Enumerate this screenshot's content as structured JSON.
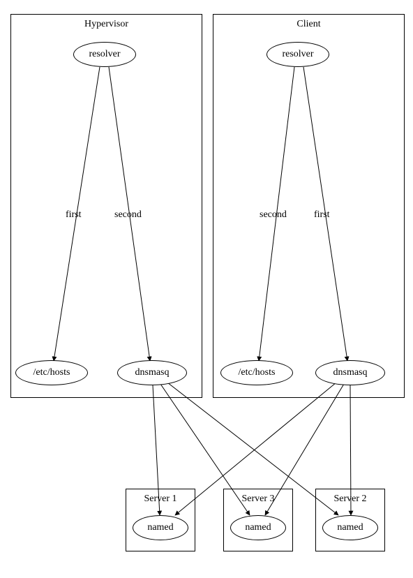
{
  "chart_data": {
    "type": "graph",
    "clusters": [
      {
        "id": "hypervisor",
        "label": "Hypervisor",
        "nodes": [
          "h_resolver",
          "h_etchosts",
          "h_dnsmasq"
        ]
      },
      {
        "id": "client",
        "label": "Client",
        "nodes": [
          "c_resolver",
          "c_etchosts",
          "c_dnsmasq"
        ]
      },
      {
        "id": "server1",
        "label": "Server 1",
        "nodes": [
          "s1_named"
        ]
      },
      {
        "id": "server3",
        "label": "Server 3",
        "nodes": [
          "s3_named"
        ]
      },
      {
        "id": "server2",
        "label": "Server 2",
        "nodes": [
          "s2_named"
        ]
      }
    ],
    "nodes": {
      "h_resolver": "resolver",
      "h_etchosts": "/etc/hosts",
      "h_dnsmasq": "dnsmasq",
      "c_resolver": "resolver",
      "c_etchosts": "/etc/hosts",
      "c_dnsmasq": "dnsmasq",
      "s1_named": "named",
      "s3_named": "named",
      "s2_named": "named"
    },
    "edges": [
      {
        "from": "h_resolver",
        "to": "h_etchosts",
        "label": "first"
      },
      {
        "from": "h_resolver",
        "to": "h_dnsmasq",
        "label": "second"
      },
      {
        "from": "c_resolver",
        "to": "c_etchosts",
        "label": "second"
      },
      {
        "from": "c_resolver",
        "to": "c_dnsmasq",
        "label": "first"
      },
      {
        "from": "h_dnsmasq",
        "to": "s1_named",
        "label": ""
      },
      {
        "from": "h_dnsmasq",
        "to": "s3_named",
        "label": ""
      },
      {
        "from": "h_dnsmasq",
        "to": "s2_named",
        "label": ""
      },
      {
        "from": "c_dnsmasq",
        "to": "s1_named",
        "label": ""
      },
      {
        "from": "c_dnsmasq",
        "to": "s3_named",
        "label": ""
      },
      {
        "from": "c_dnsmasq",
        "to": "s2_named",
        "label": ""
      }
    ]
  },
  "clusters": {
    "hypervisor": {
      "label": "Hypervisor"
    },
    "client": {
      "label": "Client"
    },
    "server1": {
      "label": "Server 1"
    },
    "server2": {
      "label": "Server 2"
    },
    "server3": {
      "label": "Server 3"
    }
  },
  "nodes": {
    "h_resolver": "resolver",
    "h_etchosts": "/etc/hosts",
    "h_dnsmasq": "dnsmasq",
    "c_resolver": "resolver",
    "c_etchosts": "/etc/hosts",
    "c_dnsmasq": "dnsmasq",
    "s1_named": "named",
    "s2_named": "named",
    "s3_named": "named"
  },
  "edge_labels": {
    "h_first": "first",
    "h_second": "second",
    "c_second": "second",
    "c_first": "first"
  }
}
